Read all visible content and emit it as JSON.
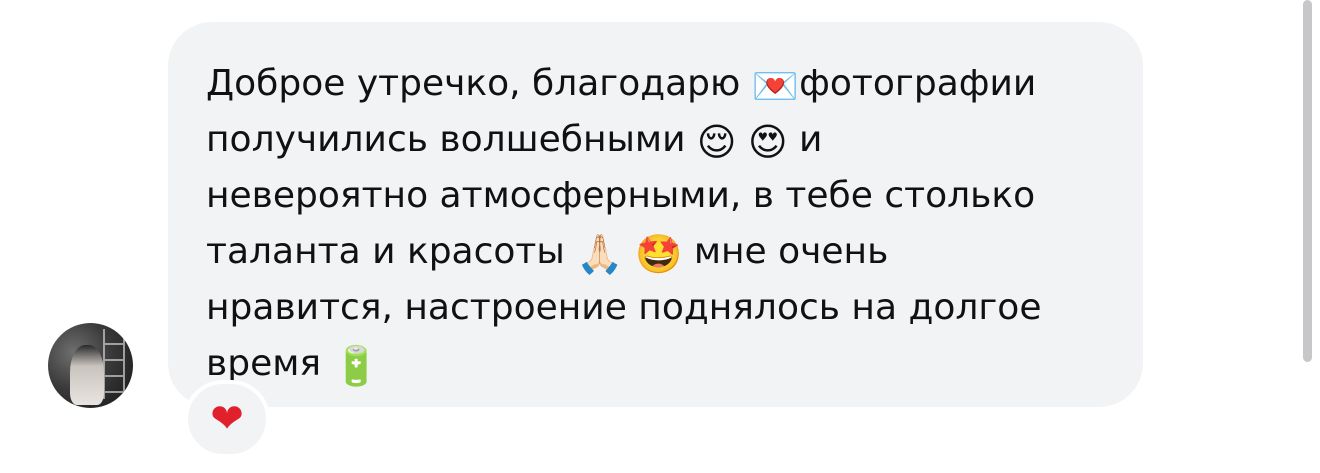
{
  "message": {
    "lines": [
      [
        "Доброе утречко, благодарю ",
        "💌",
        "фотографии"
      ],
      [
        "получились волшебными ",
        "😌",
        " ",
        "😍",
        "  и"
      ],
      [
        "невероятно атмосферными, в тебе столько"
      ],
      [
        "таланта и красоты ",
        "🙏🏻",
        " ",
        "🤩",
        " мне очень"
      ],
      [
        "нравится, настроение поднялось на долгое"
      ],
      [
        "время ",
        "🔋"
      ]
    ]
  },
  "reaction": {
    "emoji": "❤"
  },
  "colors": {
    "bubble_bg": "#f2f3f5",
    "text": "#111111",
    "heart": "#e0202a",
    "scrollbar": "#c7c7c9"
  }
}
